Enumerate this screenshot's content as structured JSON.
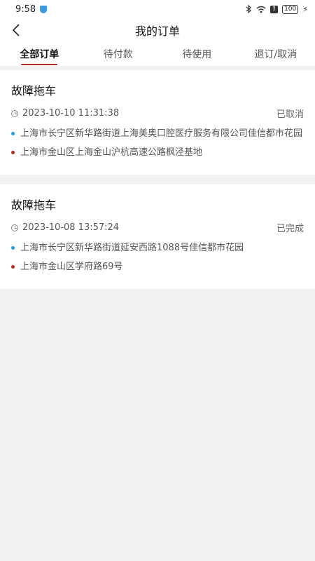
{
  "status_bar": {
    "time": "9:58",
    "battery": "100",
    "mute_label": "!",
    "icons": [
      "bluetooth-icon",
      "wifi-icon",
      "mute-icon",
      "battery-icon",
      "charging-icon"
    ]
  },
  "header": {
    "title": "我的订单",
    "back_icon": "chevron-left-icon"
  },
  "tabs": [
    {
      "label": "全部订单",
      "active": true
    },
    {
      "label": "待付款",
      "active": false
    },
    {
      "label": "待使用",
      "active": false
    },
    {
      "label": "退订/取消",
      "active": false
    }
  ],
  "orders": [
    {
      "title": "故障拖车",
      "time": "2023-10-10 11:31:38",
      "status": "已取消",
      "from": "上海市长宁区新华路街道上海美奥口腔医疗服务有限公司佳信都市花园",
      "to": "上海市金山区上海金山沪杭高速公路枫泾基地"
    },
    {
      "title": "故障拖车",
      "time": "2023-10-08 13:57:24",
      "status": "已完成",
      "from": "上海市长宁区新华路街道延安西路1088号佳信都市花园",
      "to": "上海市金山区学府路69号"
    }
  ],
  "colors": {
    "accent": "#b32a2a",
    "start_dot": "#2b9ae0",
    "end_dot": "#b0301f",
    "background": "#f2f2f2"
  }
}
